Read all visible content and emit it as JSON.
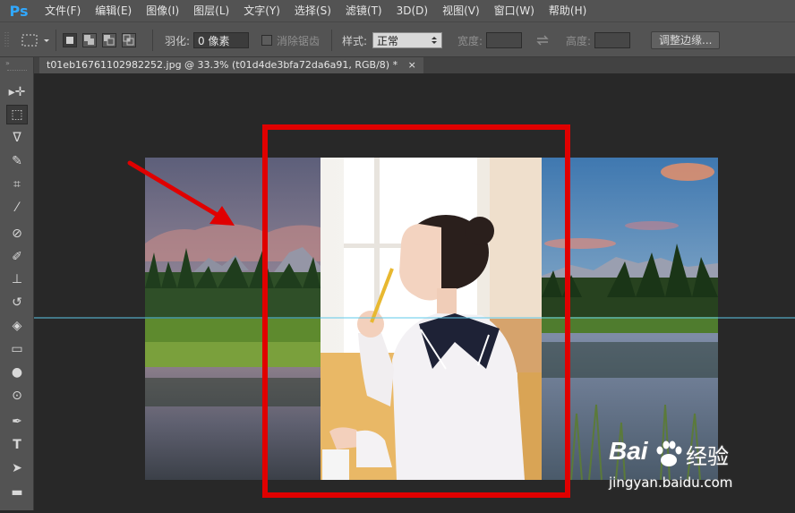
{
  "app": {
    "logo": "Ps"
  },
  "menu": [
    "文件(F)",
    "编辑(E)",
    "图像(I)",
    "图层(L)",
    "文字(Y)",
    "选择(S)",
    "滤镜(T)",
    "3D(D)",
    "视图(V)",
    "窗口(W)",
    "帮助(H)"
  ],
  "options": {
    "feather_label": "羽化:",
    "feather_value": "0 像素",
    "antialias_label": "消除锯齿",
    "style_label": "样式:",
    "style_value": "正常",
    "width_label": "宽度:",
    "height_label": "高度:",
    "refine_edge_label": "调整边缘..."
  },
  "document": {
    "tab_title": "t01eb16761102982252.jpg @ 33.3% (t01d4de3bfa72da6a91, RGB/8) *",
    "close_glyph": "×"
  },
  "toolbar_tools": [
    {
      "name": "move-tool-icon",
      "glyph": "▸✛"
    },
    {
      "name": "marquee-tool-icon",
      "glyph": "⬚"
    },
    {
      "name": "lasso-tool-icon",
      "glyph": "ᐁ"
    },
    {
      "name": "quick-select-tool-icon",
      "glyph": "✎"
    },
    {
      "name": "crop-tool-icon",
      "glyph": "⌗"
    },
    {
      "name": "eyedropper-tool-icon",
      "glyph": "⁄"
    },
    {
      "name": "healing-brush-tool-icon",
      "glyph": "⊘"
    },
    {
      "name": "brush-tool-icon",
      "glyph": "✐"
    },
    {
      "name": "clone-stamp-tool-icon",
      "glyph": "⊥"
    },
    {
      "name": "history-brush-tool-icon",
      "glyph": "↺"
    },
    {
      "name": "eraser-tool-icon",
      "glyph": "◈"
    },
    {
      "name": "gradient-tool-icon",
      "glyph": "▭"
    },
    {
      "name": "blur-tool-icon",
      "glyph": "●"
    },
    {
      "name": "dodge-tool-icon",
      "glyph": "⊙"
    },
    {
      "name": "pen-tool-icon",
      "glyph": "✒"
    },
    {
      "name": "type-tool-icon",
      "glyph": "T"
    },
    {
      "name": "path-select-tool-icon",
      "glyph": "➤"
    },
    {
      "name": "shape-tool-icon",
      "glyph": "▬"
    }
  ],
  "watermark": {
    "brand": "Bai",
    "brand_cn": "经验",
    "url": "jingyan.baidu.com"
  },
  "colors": {
    "accent": "#31a8ff",
    "guide": "#5ec8e8",
    "highlight": "#e00000"
  }
}
